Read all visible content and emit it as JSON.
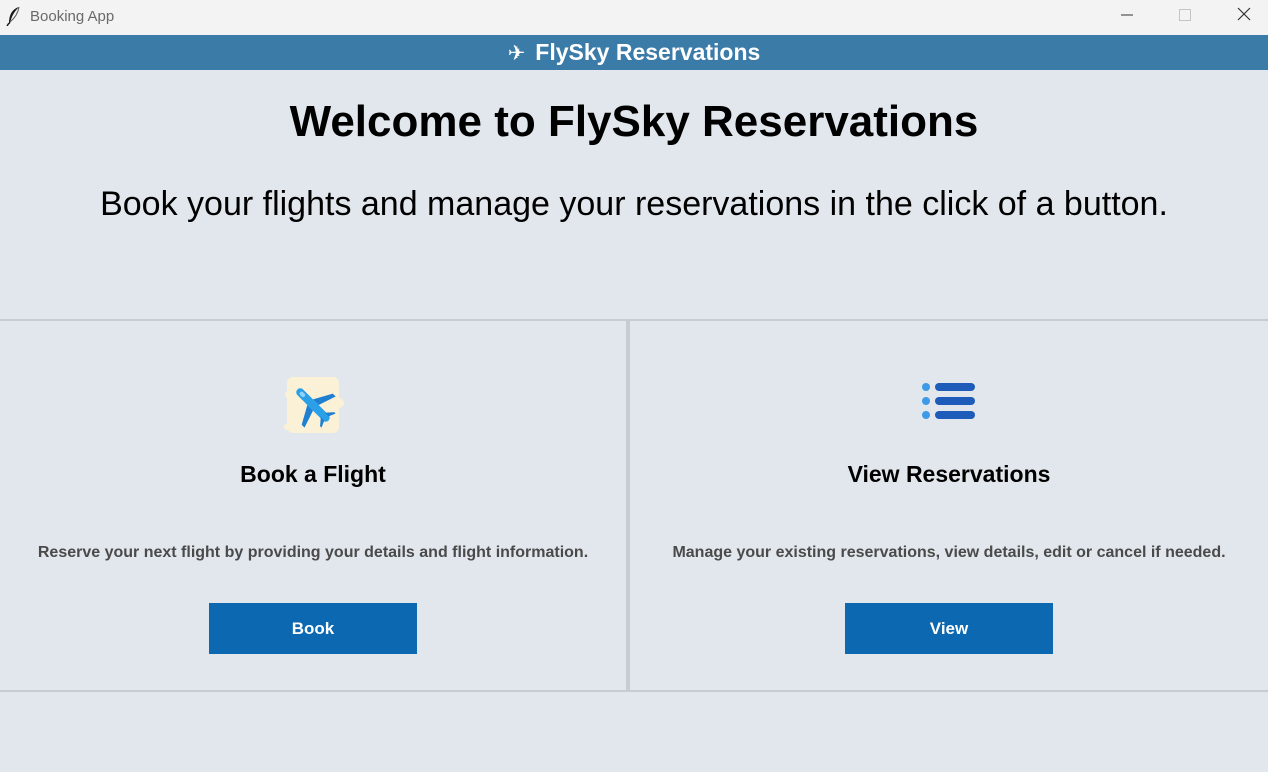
{
  "window": {
    "title": "Booking App",
    "icon": "feather-icon",
    "controls": [
      "minimize-icon",
      "maximize-icon",
      "close-icon"
    ]
  },
  "header": {
    "icon_glyph": "✈",
    "title": "FlySky Reservations",
    "background": "#3b7ba8"
  },
  "welcome": {
    "title": "Welcome to FlySky Reservations",
    "subtitle": "Book your flights and manage your reservations in the click of a button."
  },
  "cards": [
    {
      "icon": "airplane-icon",
      "title": "Book a Flight",
      "description": "Reserve your next flight by providing your details and flight information.",
      "button_label": "Book"
    },
    {
      "icon": "list-icon",
      "title": "View Reservations",
      "description": "Manage your existing reservations, view details, edit or cancel if needed.",
      "button_label": "View"
    }
  ],
  "colors": {
    "background": "#e1e7ec",
    "button": "#0c68b0",
    "header": "#3b7ba8"
  }
}
